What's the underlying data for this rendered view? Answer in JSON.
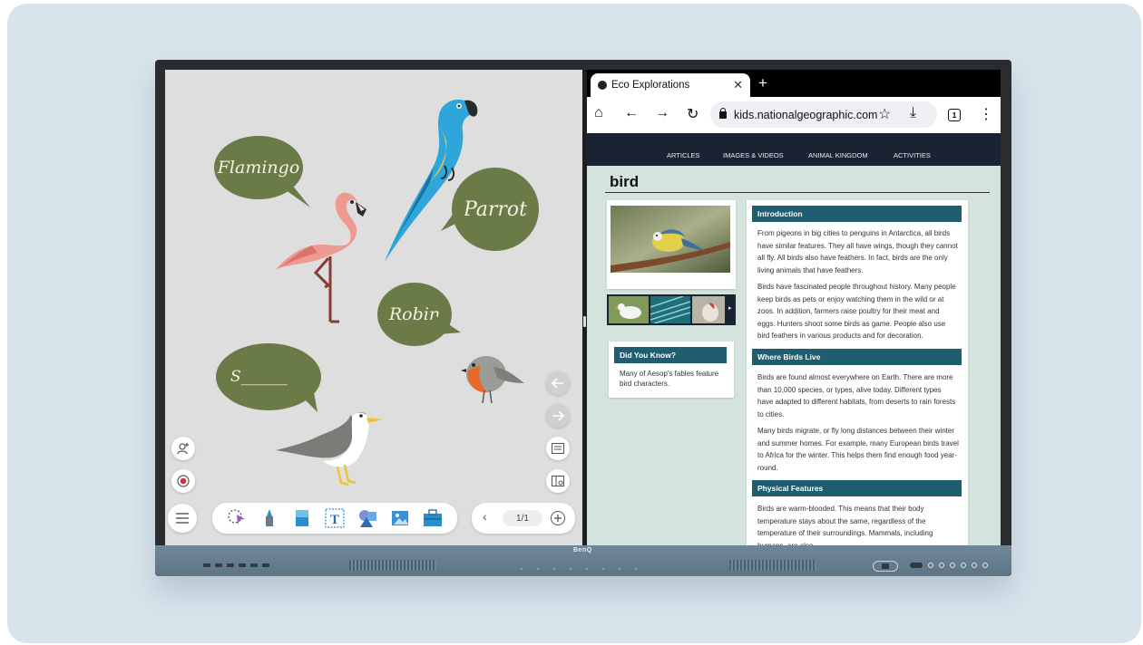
{
  "whiteboard": {
    "bubbles": {
      "flamingo": "Flamingo",
      "parrot": "Parrot",
      "robin": "Robin",
      "blank": "S______"
    },
    "page_indicator": "1/1",
    "tools": [
      "lasso-tool-icon",
      "pen-tool-icon",
      "eraser-tool-icon",
      "text-tool-icon",
      "shapes-tool-icon",
      "image-tool-icon",
      "toolbox-icon"
    ]
  },
  "browser": {
    "tab_title": "Eco Explorations",
    "url": "kids.nationalgeographic.com",
    "tab_count": "1",
    "site_nav": [
      "ARTICLES",
      "IMAGES & VIDEOS",
      "ANIMAL KINGDOM",
      "ACTIVITIES"
    ],
    "page_title": "bird",
    "did_you_know": {
      "heading": "Did You Know?",
      "text": "Many of Aesop's fables feature bird characters."
    },
    "sections": {
      "intro_heading": "Introduction",
      "intro_p1": "From pigeons in big cities to penguins in Antarctica, all birds have similar features. They all have wings, though they cannot all fly. All birds also have feathers. In fact, birds are the only living animals that have feathers.",
      "intro_p2": "Birds have fascinated people throughout history. Many people keep birds as pets or enjoy watching them in the wild or at zoos. In addition, farmers raise poultry for their meat and eggs. Hunters shoot some birds as game. People also use bird feathers in various products and for decoration.",
      "live_heading": "Where Birds Live",
      "live_p1": "Birds are found almost everywhere on Earth. There are more than 10,000 species, or types, alive today. Different types have adapted to different habitats, from deserts to rain forests to cities.",
      "live_p2": "Many birds migrate, or fly long distances between their winter and summer homes. For example, many European birds travel to Africa for the winter. This helps them find enough food year-round.",
      "phys_heading": "Physical Features",
      "phys_p1": "Birds are warm-blooded. This means that their body temperature stays about the same, regardless of the temperature of their surroundings. Mammals, including humans, are also"
    }
  },
  "monitor": {
    "brand": "BenQ"
  }
}
